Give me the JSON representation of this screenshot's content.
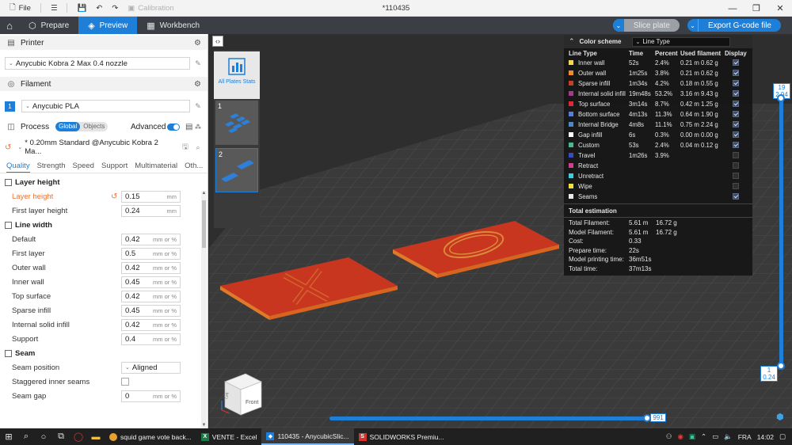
{
  "titlebar": {
    "file_label": "File",
    "calibration_label": "Calibration",
    "window_title": "*110435"
  },
  "topbar": {
    "tabs": [
      {
        "label": "Prepare"
      },
      {
        "label": "Preview"
      },
      {
        "label": "Workbench"
      }
    ],
    "slice_label": "Slice plate",
    "export_label": "Export G-code file"
  },
  "sidebar": {
    "printer_title": "Printer",
    "printer_value": "Anycubic Kobra 2 Max 0.4 nozzle",
    "filament_title": "Filament",
    "filament_index": "1",
    "filament_value": "Anycubic PLA",
    "process_title": "Process",
    "toggle_global": "Global",
    "toggle_objects": "Objects",
    "advanced_label": "Advanced",
    "process_profile": "* 0.20mm Standard @Anycubic Kobra 2 Ma...",
    "tabs": [
      "Quality",
      "Strength",
      "Speed",
      "Support",
      "Multimaterial",
      "Oth..."
    ],
    "groups": {
      "layer_height": "Layer height",
      "line_width": "Line width",
      "seam": "Seam"
    },
    "params": {
      "layer_height": {
        "label": "Layer height",
        "value": "0.15",
        "unit": "mm"
      },
      "first_layer_height": {
        "label": "First layer height",
        "value": "0.24",
        "unit": "mm"
      },
      "default": {
        "label": "Default",
        "value": "0.42",
        "unit": "mm or %"
      },
      "first_layer": {
        "label": "First layer",
        "value": "0.5",
        "unit": "mm or %"
      },
      "outer_wall": {
        "label": "Outer wall",
        "value": "0.42",
        "unit": "mm or %"
      },
      "inner_wall": {
        "label": "Inner wall",
        "value": "0.45",
        "unit": "mm or %"
      },
      "top_surface": {
        "label": "Top surface",
        "value": "0.42",
        "unit": "mm or %"
      },
      "sparse_infill": {
        "label": "Sparse infill",
        "value": "0.45",
        "unit": "mm or %"
      },
      "internal_solid_infill": {
        "label": "Internal solid infill",
        "value": "0.42",
        "unit": "mm or %"
      },
      "support": {
        "label": "Support",
        "value": "0.4",
        "unit": "mm or %"
      },
      "seam_position": {
        "label": "Seam position",
        "value": "Aligned"
      },
      "staggered_inner_seams": {
        "label": "Staggered inner seams"
      },
      "seam_gap": {
        "label": "Seam gap",
        "value": "0",
        "unit": "mm or %"
      }
    }
  },
  "plates": {
    "all_plates_label": "All Plates Stats",
    "plate1": "1",
    "plate2": "2"
  },
  "legend": {
    "color_scheme_label": "Color scheme",
    "color_scheme_value": "Line Type",
    "headers": [
      "Line Type",
      "Time",
      "Percent",
      "Used filament",
      "Display"
    ],
    "rows": [
      {
        "name": "Inner wall",
        "color": "#f5d94a",
        "time": "52s",
        "percent": "2.4%",
        "meters": "0.21 m",
        "grams": "0.62 g",
        "display": true
      },
      {
        "name": "Outer wall",
        "color": "#f08a2a",
        "time": "1m25s",
        "percent": "3.8%",
        "meters": "0.21 m",
        "grams": "0.62 g",
        "display": true
      },
      {
        "name": "Sparse infill",
        "color": "#c1402a",
        "time": "1m34s",
        "percent": "4.2%",
        "meters": "0.18 m",
        "grams": "0.55 g",
        "display": true
      },
      {
        "name": "Internal solid infill",
        "color": "#a33a8a",
        "time": "19m48s",
        "percent": "53.2%",
        "meters": "3.16 m",
        "grams": "9.43 g",
        "display": true
      },
      {
        "name": "Top surface",
        "color": "#e0283a",
        "time": "3m14s",
        "percent": "8.7%",
        "meters": "0.42 m",
        "grams": "1.25 g",
        "display": true
      },
      {
        "name": "Bottom surface",
        "color": "#5a7bd8",
        "time": "4m13s",
        "percent": "11.3%",
        "meters": "0.64 m",
        "grams": "1.90 g",
        "display": true
      },
      {
        "name": "Internal Bridge",
        "color": "#4a88c8",
        "time": "4m8s",
        "percent": "11.1%",
        "meters": "0.75 m",
        "grams": "2.24 g",
        "display": true
      },
      {
        "name": "Gap infill",
        "color": "#ffffff",
        "time": "6s",
        "percent": "0.3%",
        "meters": "0.00 m",
        "grams": "0.00 g",
        "display": true
      },
      {
        "name": "Custom",
        "color": "#4ab88a",
        "time": "53s",
        "percent": "2.4%",
        "meters": "0.04 m",
        "grams": "0.12 g",
        "display": true
      },
      {
        "name": "Travel",
        "color": "#3a4abf",
        "time": "1m26s",
        "percent": "3.9%",
        "meters": "",
        "grams": "",
        "display": false
      },
      {
        "name": "Retract",
        "color": "#d0408a",
        "time": "",
        "percent": "",
        "meters": "",
        "grams": "",
        "display": false
      },
      {
        "name": "Unretract",
        "color": "#3ad0e0",
        "time": "",
        "percent": "",
        "meters": "",
        "grams": "",
        "display": false
      },
      {
        "name": "Wipe",
        "color": "#f0e040",
        "time": "",
        "percent": "",
        "meters": "",
        "grams": "",
        "display": false
      },
      {
        "name": "Seams",
        "color": "#eaeaea",
        "time": "",
        "percent": "",
        "meters": "",
        "grams": "",
        "display": true
      }
    ],
    "total_title": "Total estimation",
    "totals": [
      {
        "key": "Total Filament:",
        "v1": "5.61 m",
        "v2": "16.72 g"
      },
      {
        "key": "Model Filament:",
        "v1": "5.61 m",
        "v2": "16.72 g"
      },
      {
        "key": "Cost:",
        "v1": "0.33",
        "v2": ""
      },
      {
        "key": "Prepare time:",
        "v1": "22s",
        "v2": ""
      },
      {
        "key": "Model printing time:",
        "v1": "36m51s",
        "v2": ""
      },
      {
        "key": "Total time:",
        "v1": "37m13s",
        "v2": ""
      }
    ]
  },
  "layer_slider": {
    "top_layer": "19",
    "top_height": "2.94",
    "bottom_layer": "1",
    "bottom_height": "0.24"
  },
  "move_slider": {
    "value": "991"
  },
  "viewcube": {
    "front_label": "Front",
    "left_label": "Left"
  },
  "taskbar": {
    "apps": [
      {
        "label": "squid game vote back...",
        "icon_color": "#e8a030"
      },
      {
        "label": "VENTE - Excel",
        "icon_color": "#1d7a45"
      },
      {
        "label": "110435 - AnycubicSlic...",
        "icon_color": "#1e7fd8"
      },
      {
        "label": "SOLIDWORKS Premiu...",
        "icon_color": "#d0342c"
      }
    ],
    "lang": "FRA",
    "time": "14:02"
  }
}
